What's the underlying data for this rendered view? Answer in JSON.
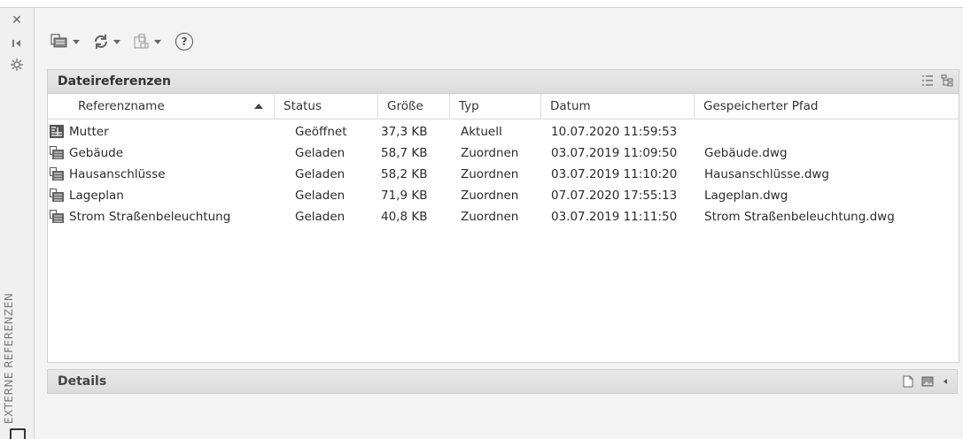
{
  "palette": "vertical",
  "sidebar": {
    "title": "EXTERNE REFERENZEN"
  },
  "panel": {
    "title": "Dateireferenzen"
  },
  "columns": [
    "Referenzname",
    "Status",
    "Größe",
    "Typ",
    "Datum",
    "Gespeicherter Pfad"
  ],
  "rows": [
    {
      "name": "Mutter",
      "status": "Geöffnet",
      "size": "37,3 KB",
      "type": "Aktuell",
      "date": "10.07.2020 11:59:53",
      "path": ""
    },
    {
      "name": "Gebäude",
      "status": "Geladen",
      "size": "58,7 KB",
      "type": "Zuordnen",
      "date": "03.07.2019 11:09:50",
      "path": "Gebäude.dwg"
    },
    {
      "name": "Hausanschlüsse",
      "status": "Geladen",
      "size": "58,2 KB",
      "type": "Zuordnen",
      "date": "03.07.2019 11:10:20",
      "path": "Hausanschlüsse.dwg"
    },
    {
      "name": "Lageplan",
      "status": "Geladen",
      "size": "71,9 KB",
      "type": "Zuordnen",
      "date": "07.07.2020 17:55:13",
      "path": "Lageplan.dwg"
    },
    {
      "name": "Strom Straßenbeleuchtung",
      "status": "Geladen",
      "size": "40,8 KB",
      "type": "Zuordnen",
      "date": "03.07.2019 11:11:50",
      "path": "Strom Straßenbeleuchtung.dwg"
    }
  ],
  "details": {
    "title": "Details"
  },
  "icons": [
    "close-icon",
    "auto-hide-icon",
    "properties-icon",
    "attach-dwg-icon",
    "refresh-icon",
    "change-path-icon",
    "help-icon",
    "list-view-icon",
    "tree-view-icon",
    "details-icon",
    "preview-icon",
    "collapse-icon",
    "host-drawing-icon",
    "xref-drawing-icon",
    "clip-icon"
  ]
}
